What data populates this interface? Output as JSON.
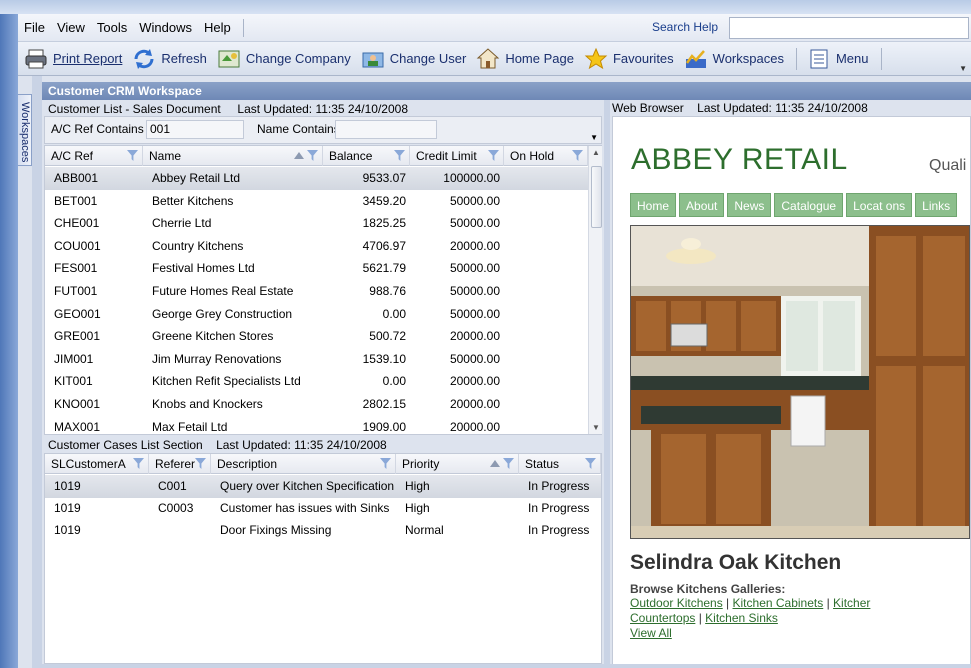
{
  "menu": {
    "items": [
      "File",
      "View",
      "Tools",
      "Windows",
      "Help"
    ],
    "search_label": "Search Help",
    "search_value": ""
  },
  "toolbar": {
    "print_report": "Print Report",
    "refresh": "Refresh",
    "change_company": "Change Company",
    "change_user": "Change User",
    "home_page": "Home Page",
    "favourites": "Favourites",
    "workspaces": "Workspaces",
    "menu": "Menu"
  },
  "workspaces_tab": "Workspaces",
  "workspace_title": "Customer CRM Workspace",
  "customer_list": {
    "title": "Customer List - Sales Document",
    "last_updated": "Last Updated: 11:35 24/10/2008",
    "filter_ac_label": "A/C Ref Contains",
    "filter_ac_value": "001",
    "filter_name_label": "Name Contains",
    "filter_name_value": "",
    "columns": [
      "A/C Ref",
      "Name",
      "Balance",
      "Credit Limit",
      "On Hold"
    ],
    "rows": [
      [
        "ABB001",
        "Abbey Retail Ltd",
        "9533.07",
        "100000.00",
        ""
      ],
      [
        "BET001",
        "Better Kitchens",
        "3459.20",
        "50000.00",
        ""
      ],
      [
        "CHE001",
        "Cherrie Ltd",
        "1825.25",
        "50000.00",
        ""
      ],
      [
        "COU001",
        "Country Kitchens",
        "4706.97",
        "20000.00",
        ""
      ],
      [
        "FES001",
        "Festival Homes Ltd",
        "5621.79",
        "50000.00",
        ""
      ],
      [
        "FUT001",
        "Future Homes Real Estate",
        "988.76",
        "50000.00",
        ""
      ],
      [
        "GEO001",
        "George Grey Construction",
        "0.00",
        "50000.00",
        ""
      ],
      [
        "GRE001",
        "Greene Kitchen Stores",
        "500.72",
        "20000.00",
        ""
      ],
      [
        "JIM001",
        "Jim Murray Renovations",
        "1539.10",
        "50000.00",
        ""
      ],
      [
        "KIT001",
        "Kitchen Refit Specialists Ltd",
        "0.00",
        "20000.00",
        ""
      ],
      [
        "KNO001",
        "Knobs and Knockers",
        "2802.15",
        "20000.00",
        ""
      ],
      [
        "MAX001",
        "Max Fetail Ltd",
        "1909.00",
        "20000.00",
        ""
      ]
    ]
  },
  "cases": {
    "title": "Customer Cases List Section",
    "last_updated": "Last Updated: 11:35 24/10/2008",
    "columns": [
      "SLCustomerA",
      "Referer",
      "Description",
      "Priority",
      "Status"
    ],
    "rows": [
      [
        "1019",
        "C001",
        "Query over Kitchen Specification",
        "High",
        "In Progress"
      ],
      [
        "1019",
        "C0003",
        "Customer has issues with Sinks",
        "High",
        "In Progress"
      ],
      [
        "1019",
        "",
        "Door Fixings Missing",
        "Normal",
        "In Progress"
      ]
    ]
  },
  "web_browser": {
    "title": "Web Browser",
    "last_updated": "Last Updated: 11:35 24/10/2008",
    "brand": "ABBEY RETAIL",
    "tagline": "Quali",
    "nav": [
      "Home",
      "About",
      "News",
      "Catalogue",
      "Locat ons",
      "Links"
    ],
    "heading": "Selindra Oak Kitchen",
    "sub": "Browse Kitchens Galleries:",
    "links": [
      "Outdoor Kitchens",
      "Kitchen Cabinets",
      "Kitcher",
      "Countertops",
      "Kitchen Sinks",
      "View All"
    ]
  },
  "colors": {
    "brand_green": "#2d6e2d",
    "nav_green": "#8cbf8c",
    "header_blue": "#6e88b6"
  }
}
